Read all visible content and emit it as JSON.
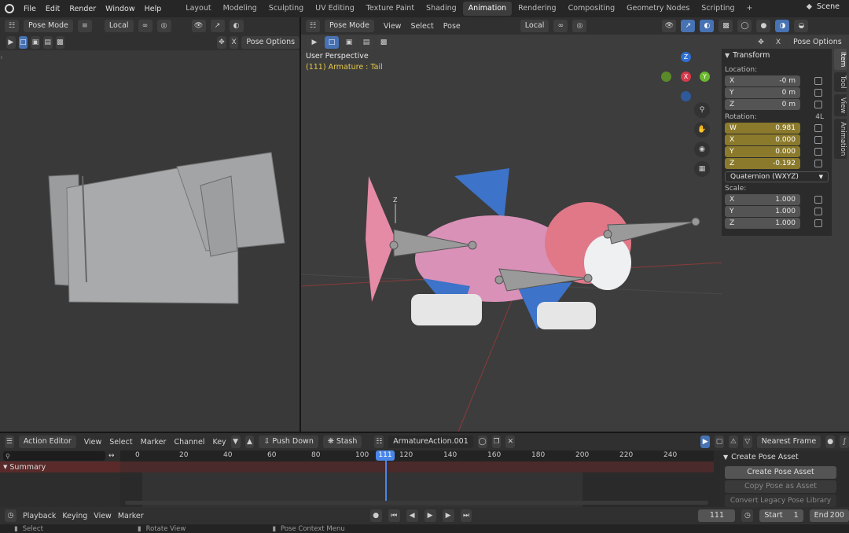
{
  "menu": [
    "File",
    "Edit",
    "Render",
    "Window",
    "Help"
  ],
  "workspaces": [
    "Layout",
    "Modeling",
    "Sculpting",
    "UV Editing",
    "Texture Paint",
    "Shading",
    "Animation",
    "Rendering",
    "Compositing",
    "Geometry Nodes",
    "Scripting"
  ],
  "active_workspace": "Animation",
  "add_tab": "+",
  "scene": "Scene",
  "left_view": {
    "mode": "Pose Mode",
    "orientation": "Local",
    "pose_options": "Pose Options",
    "x_label": "X"
  },
  "main_view": {
    "mode": "Pose Mode",
    "menus": [
      "View",
      "Select",
      "Pose"
    ],
    "orientation": "Local",
    "perspective": "User Perspective",
    "active_object": "(111) Armature : Tail",
    "pose_options": "Pose Options",
    "x_label": "X",
    "gizmo": {
      "x": "X",
      "y": "Y",
      "z": "Z"
    },
    "bone_axis_label": "Z"
  },
  "side_tabs": [
    "Item",
    "Tool",
    "View",
    "Animation"
  ],
  "transform": {
    "title": "Transform",
    "location_label": "Location:",
    "location": [
      {
        "axis": "X",
        "value": "-0 m"
      },
      {
        "axis": "Y",
        "value": "0 m"
      },
      {
        "axis": "Z",
        "value": "0 m"
      }
    ],
    "rotation_label": "Rotation:",
    "rotation_mode_short": "4L",
    "rotation": [
      {
        "axis": "W",
        "value": "0.981"
      },
      {
        "axis": "X",
        "value": "0.000"
      },
      {
        "axis": "Y",
        "value": "0.000"
      },
      {
        "axis": "Z",
        "value": "-0.192"
      }
    ],
    "rotation_mode": "Quaternion (WXYZ)",
    "scale_label": "Scale:",
    "scale": [
      {
        "axis": "X",
        "value": "1.000"
      },
      {
        "axis": "Y",
        "value": "1.000"
      },
      {
        "axis": "Z",
        "value": "1.000"
      }
    ]
  },
  "action_editor": {
    "editor": "Action Editor",
    "menus": [
      "View",
      "Select",
      "Marker",
      "Channel",
      "Key"
    ],
    "push_down": "Push Down",
    "stash": "Stash",
    "action": "ArmatureAction.001",
    "snap": "Nearest Frame",
    "ticks": [
      "0",
      "20",
      "40",
      "60",
      "80",
      "100",
      "111",
      "120",
      "140",
      "160",
      "180",
      "200",
      "220",
      "240"
    ],
    "current_frame": "111",
    "summary": "Summary"
  },
  "pose_asset": {
    "title": "Create Pose Asset",
    "create": "Create Pose Asset",
    "copy": "Copy Pose as Asset",
    "convert": "Convert Legacy Pose Library"
  },
  "playback": {
    "menus": [
      "Playback",
      "Keying",
      "View",
      "Marker"
    ],
    "frame": "111",
    "start_label": "Start",
    "start": "1",
    "end_label": "End",
    "end": "200"
  },
  "status": [
    "Select",
    "Rotate View",
    "Pose Context Menu"
  ]
}
